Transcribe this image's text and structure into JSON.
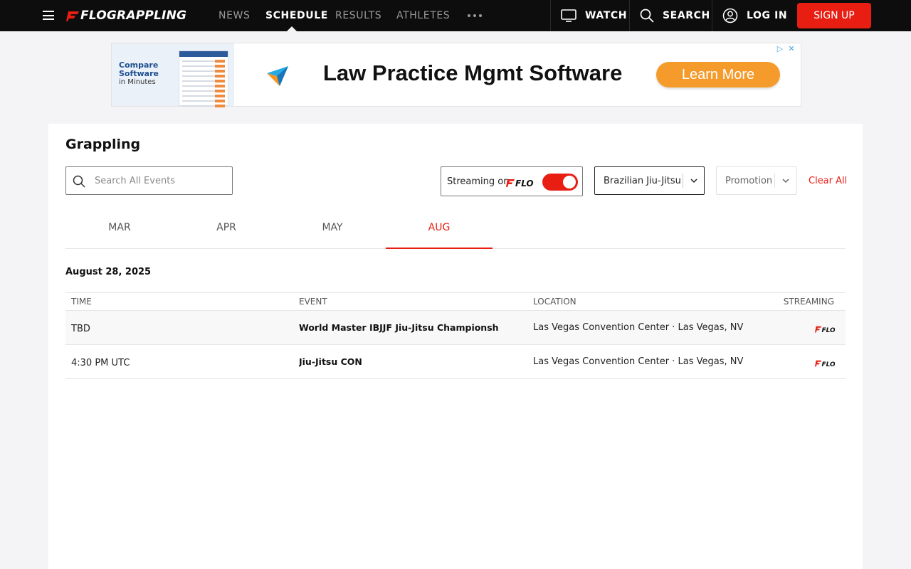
{
  "nav": {
    "brand": "FLOGRAPPLING",
    "links": [
      "NEWS",
      "SCHEDULE",
      "RESULTS",
      "ATHLETES"
    ],
    "active": "SCHEDULE",
    "watch": "WATCH",
    "search": "SEARCH",
    "login": "LOG IN",
    "signup": "SIGN UP",
    "accent": "#e81e13"
  },
  "ad": {
    "left_line1": "Compare",
    "left_line2": "Software",
    "left_line3": "in Minutes",
    "headline": "Law Practice Mgmt Software",
    "cta": "Learn More"
  },
  "page": {
    "title": "Grappling",
    "search_placeholder": "Search All Events",
    "streaming_label": "Streaming on",
    "streaming_brand": "FLO",
    "streaming_on": true,
    "sport_filter": "Brazilian Jiu-Jitsu",
    "promotion_filter": "Promotion",
    "clear_all": "Clear All"
  },
  "months": [
    {
      "label": "MAR",
      "active": false
    },
    {
      "label": "APR",
      "active": false
    },
    {
      "label": "MAY",
      "active": false
    },
    {
      "label": "AUG",
      "active": true
    }
  ],
  "schedule": {
    "date": "August 28, 2025",
    "columns": {
      "time": "TIME",
      "event": "EVENT",
      "location": "LOCATION",
      "streaming": "STREAMING"
    },
    "rows": [
      {
        "time": "TBD",
        "event": "World Master IBJJF Jiu-Jitsu Championsh",
        "location": "Las Vegas Convention Center · Las Vegas, NV",
        "streaming": "FLO"
      },
      {
        "time": "4:30 PM UTC",
        "event": "Jiu-Jitsu CON",
        "location": "Las Vegas Convention Center · Las Vegas, NV",
        "streaming": "FLO"
      }
    ]
  }
}
